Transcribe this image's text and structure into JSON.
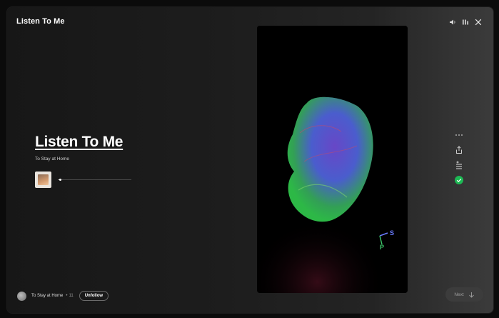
{
  "modal": {
    "title": "Listen To Me",
    "top_icons": [
      "volume-icon",
      "bars-icon",
      "close-icon"
    ]
  },
  "content": {
    "big_title": "Listen To Me",
    "subtitle": "To Stay at Home",
    "player": {
      "progress": 0.02
    }
  },
  "video": {
    "axis_labels": {
      "s": "S",
      "p": "P"
    }
  },
  "side_actions": [
    "more-icon",
    "share-icon",
    "add-to-queue-icon",
    "check-icon"
  ],
  "footer": {
    "channel_name": "To Stay at Home",
    "separator": "•",
    "count": "11",
    "unfollow_label": "Unfollow"
  },
  "next_label": "Next",
  "colors": {
    "accent_green": "#1db954"
  }
}
